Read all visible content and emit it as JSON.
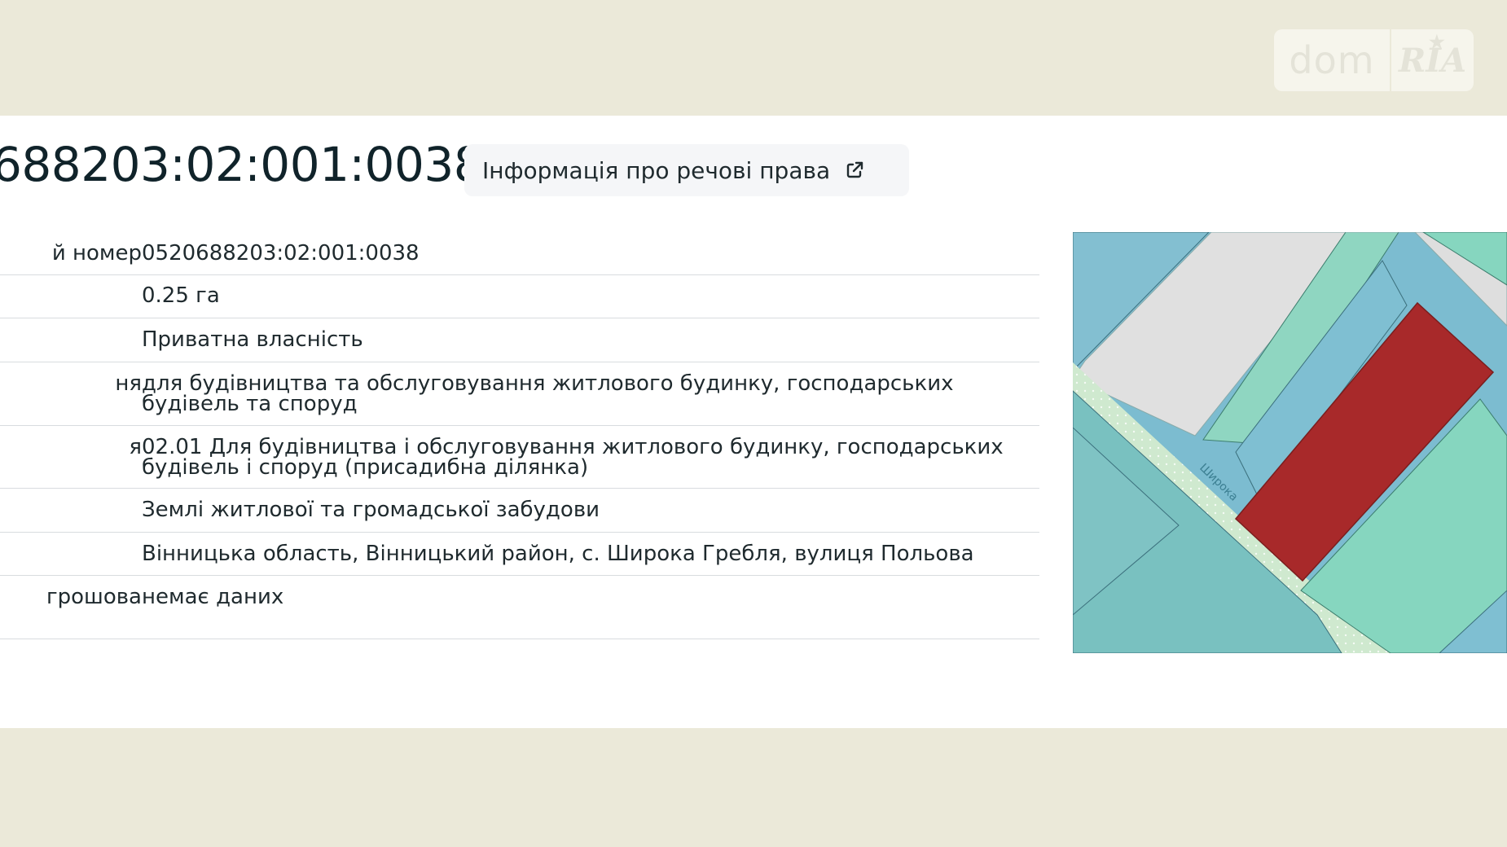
{
  "logo": {
    "left_text": "dom",
    "right_text": "RIA"
  },
  "header": {
    "cadastral_number_display": "688203:02:001:0038",
    "rights_button_label": "Інформація про речові права"
  },
  "table": {
    "rows": [
      {
        "label": "й номер",
        "value": "0520688203:02:001:0038"
      },
      {
        "label": "",
        "value": "0.25 га"
      },
      {
        "label": "",
        "value": "Приватна власність"
      },
      {
        "label": "ня",
        "value": "для будівництва та обслуговування житлового будинку, господарських будівель та споруд"
      },
      {
        "label": "я",
        "value": "02.01 Для будівництва і обслуговування житлового будинку, господарських будівель і споруд (присадибна ділянка)"
      },
      {
        "label": "",
        "value": "Землі житлової та громадської забудови"
      },
      {
        "label": "",
        "value": "Вінницька область, Вінницький район, с. Широка Гребля, вулиця Польова"
      },
      {
        "label": "грошова",
        "value": "немає даних"
      }
    ]
  },
  "map": {
    "street_label": "Широка",
    "colors": {
      "selected_parcel": "#a8292a",
      "parcel_blue": "#7cbcd0",
      "parcel_green": "#86d6bf",
      "road": "#cfe9cf",
      "building": "#e0e0e0"
    }
  }
}
